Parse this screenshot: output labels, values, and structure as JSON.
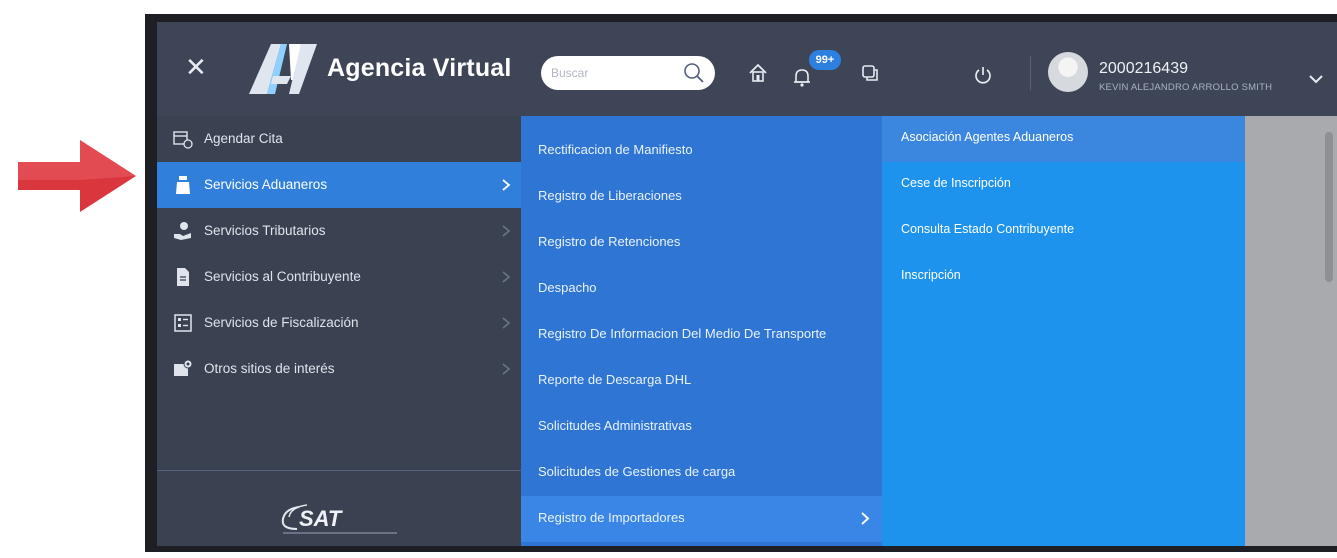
{
  "header": {
    "app_title": "Agencia Virtual",
    "search_placeholder": "Buscar",
    "notification_count": "99+",
    "user_id": "2000216439",
    "user_name": "KEVIN ALEJANDRO ARROLLO SMITH"
  },
  "sidebar": {
    "items": [
      {
        "label": "Agendar Cita",
        "icon": "calendar-clock-icon"
      },
      {
        "label": "Servicios Aduaneros",
        "icon": "customs-icon"
      },
      {
        "label": "Servicios Tributarios",
        "icon": "tax-hand-icon"
      },
      {
        "label": "Servicios al Contribuyente",
        "icon": "document-icon"
      },
      {
        "label": "Servicios de Fiscalización",
        "icon": "audit-list-icon"
      },
      {
        "label": "Otros sitios de interés",
        "icon": "location-screen-icon"
      }
    ],
    "active_index": 1,
    "footer_logo": "SAT"
  },
  "submenu": {
    "items": [
      {
        "label": "Rectificacion de Manifiesto"
      },
      {
        "label": "Registro de Liberaciones"
      },
      {
        "label": "Registro de Retenciones"
      },
      {
        "label": "Despacho"
      },
      {
        "label": "Registro De Informacion Del Medio De Transporte"
      },
      {
        "label": "Reporte de Descarga DHL"
      },
      {
        "label": "Solicitudes Administrativas"
      },
      {
        "label": "Solicitudes de Gestiones de carga"
      },
      {
        "label": "Registro de Importadores"
      }
    ],
    "active_index": 8
  },
  "subsubmenu": {
    "items": [
      {
        "label": "Asociación Agentes Aduaneros"
      },
      {
        "label": "Cese de Inscripción"
      },
      {
        "label": "Consulta Estado Contribuyente"
      },
      {
        "label": "Inscripción"
      }
    ],
    "active_index": 0
  },
  "colors": {
    "header_bg": "#3d4556",
    "sidebar_bg": "#3a4252",
    "active_blue": "#2f7fdb",
    "submenu_bg": "#2f75d3",
    "subsubmenu_bg": "#1e93ee",
    "arrow_red": "#e0353f"
  }
}
